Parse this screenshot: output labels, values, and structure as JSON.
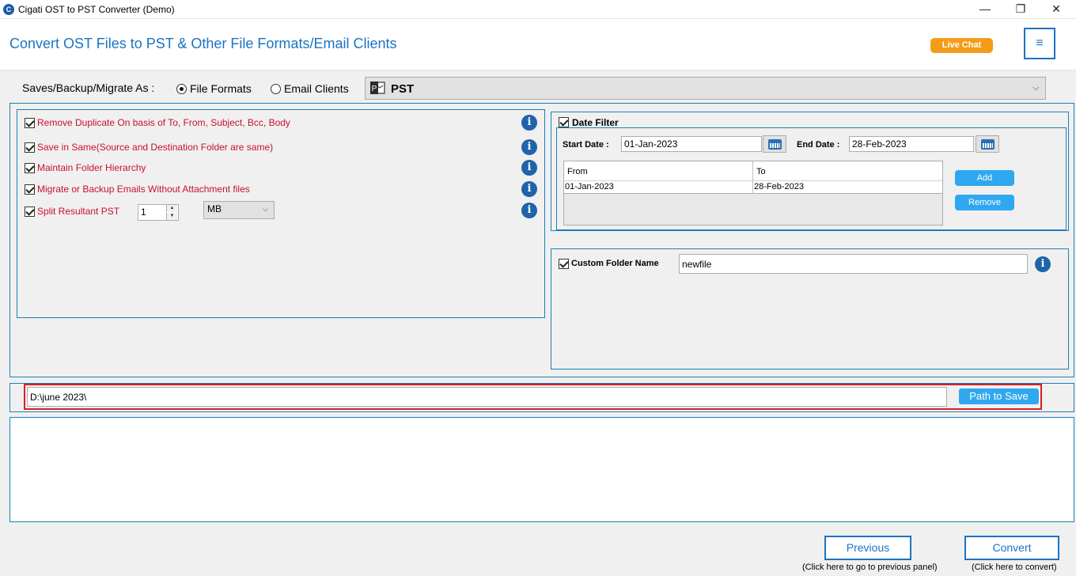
{
  "window": {
    "title": "Cigati OST to PST Converter (Demo)",
    "app_icon": "C",
    "minimize_glyph": "—",
    "maximize_glyph": "❐",
    "close_glyph": "✕"
  },
  "header": {
    "title": "Convert OST Files to PST & Other File Formats/Email Clients",
    "live_chat_label": "Live Chat",
    "menu_icon": "≡"
  },
  "save_as": {
    "label": "Saves/Backup/Migrate As :",
    "radio_file_formats": "File Formats",
    "radio_email_clients": "Email Clients",
    "selected_radio": "File Formats",
    "selected_format": "PST",
    "format_icon": "P"
  },
  "options": {
    "items": [
      {
        "label": "Remove Duplicate On basis of To, From, Subject, Bcc, Body",
        "checked": true
      },
      {
        "label": "Save in Same(Source and Destination Folder are same)",
        "checked": true
      },
      {
        "label": "Maintain Folder Hierarchy",
        "checked": true
      },
      {
        "label": "Migrate or Backup Emails Without Attachment files",
        "checked": true
      },
      {
        "label": "Split Resultant PST",
        "checked": true
      }
    ],
    "info_glyph": "i",
    "split_size": "1",
    "split_unit": "MB",
    "spin_up": "▲",
    "spin_down": "▼",
    "chevron": "⌵"
  },
  "date_filter": {
    "label": "Date Filter",
    "enabled": true,
    "start_label": "Start Date :",
    "start_value": "01-Jan-2023",
    "end_label": "End Date :",
    "end_value": "28-Feb-2023",
    "grid_columns": [
      "From",
      "To"
    ],
    "grid_rows": [
      [
        "01-Jan-2023",
        "28-Feb-2023"
      ]
    ],
    "add_label": "Add",
    "remove_label": "Remove"
  },
  "custom_folder": {
    "label": "Custom Folder Name",
    "enabled": true,
    "value": "newfile"
  },
  "destination": {
    "path": "D:\\june 2023\\",
    "button_label": "Path to Save"
  },
  "footer": {
    "previous_label": "Previous",
    "previous_hint": "(Click here to go to previous panel)",
    "convert_label": "Convert",
    "convert_hint": "(Click here to convert)"
  },
  "colors": {
    "accent_blue": "#1b73c4",
    "option_red": "#c8102e",
    "live_chat_orange": "#f59b1b",
    "button_blue": "#30a8f0",
    "highlight_red": "#d81e27"
  }
}
